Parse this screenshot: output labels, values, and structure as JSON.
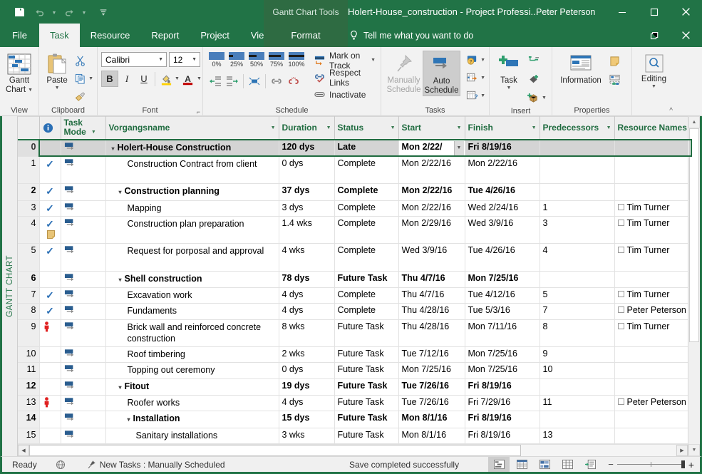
{
  "titlebar": {
    "context_tab_group": "Gantt Chart Tools",
    "document_title": "Holert-House_construction - Project Professi...",
    "user": "Peter Peterson",
    "quick_access": [
      "save-icon",
      "undo-icon",
      "redo-icon",
      "customize-icon"
    ],
    "window_buttons": [
      "minimize",
      "maximize",
      "close"
    ]
  },
  "tabs": {
    "file": "File",
    "items": [
      "Task",
      "Resource",
      "Report",
      "Project",
      "View"
    ],
    "active": "Task",
    "context": "Format",
    "tellme": "Tell me what you want to do"
  },
  "ribbon": {
    "groups": [
      {
        "name": "View",
        "label": "View",
        "buttons": [
          {
            "label_line1": "Gantt",
            "label_line2": "Chart",
            "has_caret": true
          }
        ]
      },
      {
        "name": "Clipboard",
        "label": "Clipboard",
        "buttons": [
          {
            "label_line1": "Paste",
            "has_caret": true
          }
        ],
        "mini": [
          "cut-icon",
          "copy-icon",
          "format-painter-icon"
        ]
      },
      {
        "name": "Font",
        "label": "Font",
        "font_name": "Calibri",
        "font_size": "12",
        "bold": "B",
        "italic": "I",
        "underline": "U",
        "bold_active": true,
        "fill_color": "#ffd100",
        "font_color": "#c00000"
      },
      {
        "name": "Schedule",
        "label": "Schedule",
        "percent_buttons": [
          "0%",
          "25%",
          "50%",
          "75%",
          "100%"
        ],
        "text_buttons": [
          "Mark on Track",
          "Respect Links",
          "Inactivate"
        ]
      },
      {
        "name": "Tasks",
        "label": "Tasks",
        "buttons": [
          {
            "label_line1": "Manually",
            "label_line2": "Schedule",
            "disabled": true
          },
          {
            "label_line1": "Auto",
            "label_line2": "Schedule",
            "active": true
          }
        ]
      },
      {
        "name": "Insert",
        "label": "Insert",
        "buttons": [
          {
            "label_line1": "Task",
            "has_caret": true
          }
        ]
      },
      {
        "name": "Properties",
        "label": "Properties",
        "buttons": [
          {
            "label_line1": "Information"
          }
        ]
      },
      {
        "name": "Editing",
        "label": "",
        "buttons": [
          {
            "label_line1": "Editing",
            "has_caret": true
          }
        ]
      }
    ]
  },
  "view_label": "GANTT CHART",
  "table": {
    "columns": [
      {
        "key": "rownum",
        "label": ""
      },
      {
        "key": "indicator",
        "label": "",
        "icon": "info-icon"
      },
      {
        "key": "mode",
        "label_line1": "Task",
        "label_line2": "Mode",
        "caret": true
      },
      {
        "key": "name",
        "label": "Vorgangsname",
        "caret": true
      },
      {
        "key": "duration",
        "label": "Duration",
        "caret": true
      },
      {
        "key": "status",
        "label": "Status",
        "caret": true
      },
      {
        "key": "start",
        "label": "Start",
        "caret": true
      },
      {
        "key": "finish",
        "label": "Finish",
        "caret": true
      },
      {
        "key": "predecessors",
        "label": "Predecessors",
        "caret": true
      },
      {
        "key": "resources",
        "label": "Resource Names",
        "caret": false
      }
    ],
    "rows": [
      {
        "id": "0",
        "indicator": "",
        "level": 0,
        "summary": true,
        "selected": true,
        "name": "Holert-House Construction",
        "duration": "120 dys",
        "status": "Late",
        "start": "Mon 2/22/",
        "start_editing": true,
        "finish": "Fri 8/19/16",
        "predecessors": "",
        "resources": "",
        "tall": false
      },
      {
        "id": "1",
        "indicator": "check",
        "level": 2,
        "summary": false,
        "name": "Construction Contract from client",
        "duration": "0 dys",
        "status": "Complete",
        "start": "Mon 2/22/16",
        "finish": "Mon 2/22/16",
        "predecessors": "",
        "resources": "",
        "tall": true
      },
      {
        "id": "2",
        "indicator": "check",
        "level": 1,
        "summary": true,
        "name": "Construction planning",
        "duration": "37 dys",
        "status": "Complete",
        "start": "Mon 2/22/16",
        "finish": "Tue 4/26/16",
        "predecessors": "",
        "resources": "",
        "tall": false
      },
      {
        "id": "3",
        "indicator": "check",
        "level": 2,
        "summary": false,
        "name": "Mapping",
        "duration": "3 dys",
        "status": "Complete",
        "start": "Mon 2/22/16",
        "finish": "Wed 2/24/16",
        "predecessors": "1",
        "resources": "Tim Turner",
        "tall": false
      },
      {
        "id": "4",
        "indicator": "check-notes",
        "level": 2,
        "summary": false,
        "name": "Construction plan preparation",
        "duration": "1.4 wks",
        "status": "Complete",
        "start": "Mon 2/29/16",
        "finish": "Wed 3/9/16",
        "predecessors": "3",
        "resources": "Tim Turner",
        "tall": true
      },
      {
        "id": "5",
        "indicator": "check",
        "level": 2,
        "summary": false,
        "name": "Request for porposal and approval",
        "duration": "4 wks",
        "status": "Complete",
        "start": "Wed 3/9/16",
        "finish": "Tue 4/26/16",
        "predecessors": "4",
        "resources": "Tim Turner",
        "tall": true
      },
      {
        "id": "6",
        "indicator": "",
        "level": 1,
        "summary": true,
        "name": "Shell construction",
        "duration": "78 dys",
        "status": "Future Task",
        "start": "Thu 4/7/16",
        "finish": "Mon 7/25/16",
        "predecessors": "",
        "resources": "",
        "tall": false
      },
      {
        "id": "7",
        "indicator": "check",
        "level": 2,
        "summary": false,
        "name": "Excavation work",
        "duration": "4 dys",
        "status": "Complete",
        "start": "Thu 4/7/16",
        "finish": "Tue 4/12/16",
        "predecessors": "5",
        "resources": "Tim Turner",
        "tall": false
      },
      {
        "id": "8",
        "indicator": "check",
        "level": 2,
        "summary": false,
        "name": "Fundaments",
        "duration": "4 dys",
        "status": "Complete",
        "start": "Thu 4/28/16",
        "finish": "Tue 5/3/16",
        "predecessors": "7",
        "resources": "Peter Peterson",
        "tall": false
      },
      {
        "id": "9",
        "indicator": "overalloc",
        "level": 2,
        "summary": false,
        "name": "Brick wall and reinforced concrete construction",
        "duration": "8 wks",
        "status": "Future Task",
        "start": "Thu 4/28/16",
        "finish": "Mon 7/11/16",
        "predecessors": "8",
        "resources": "Tim Turner",
        "tall": true
      },
      {
        "id": "10",
        "indicator": "",
        "level": 2,
        "summary": false,
        "name": "Roof timbering",
        "duration": "2 wks",
        "status": "Future Task",
        "start": "Tue 7/12/16",
        "finish": "Mon 7/25/16",
        "predecessors": "9",
        "resources": "",
        "tall": false
      },
      {
        "id": "11",
        "indicator": "",
        "level": 2,
        "summary": false,
        "name": "Topping out ceremony",
        "duration": "0 dys",
        "status": "Future Task",
        "start": "Mon 7/25/16",
        "finish": "Mon 7/25/16",
        "predecessors": "10",
        "resources": "",
        "tall": false
      },
      {
        "id": "12",
        "indicator": "",
        "level": 1,
        "summary": true,
        "name": "Fitout",
        "duration": "19 dys",
        "status": "Future Task",
        "start": "Tue 7/26/16",
        "finish": "Fri 8/19/16",
        "predecessors": "",
        "resources": "",
        "tall": false
      },
      {
        "id": "13",
        "indicator": "overalloc",
        "level": 2,
        "summary": false,
        "name": "Roofer works",
        "duration": "4 dys",
        "status": "Future Task",
        "start": "Tue 7/26/16",
        "finish": "Fri 7/29/16",
        "predecessors": "11",
        "resources": "Peter Peterson",
        "tall": false
      },
      {
        "id": "14",
        "indicator": "",
        "level": 2,
        "summary": true,
        "name": "Installation",
        "duration": "15 dys",
        "status": "Future Task",
        "start": "Mon 8/1/16",
        "finish": "Fri 8/19/16",
        "predecessors": "",
        "resources": "",
        "tall": false
      },
      {
        "id": "15",
        "indicator": "",
        "level": 3,
        "summary": false,
        "name": "Sanitary installations",
        "duration": "3 wks",
        "status": "Future Task",
        "start": "Mon 8/1/16",
        "finish": "Fri 8/19/16",
        "predecessors": "13",
        "resources": "",
        "tall": false
      }
    ]
  },
  "statusbar": {
    "ready": "Ready",
    "new_tasks": "New Tasks : Manually Scheduled",
    "message": "Save completed successfully",
    "view_buttons": [
      "gantt-chart-view-icon",
      "task-usage-view-icon",
      "team-planner-view-icon",
      "resource-sheet-view-icon",
      "reports-view-icon"
    ],
    "zoom_out": "−",
    "zoom_in": "+"
  },
  "colors": {
    "brand_green": "#217346",
    "header_text": "#1f6b3f",
    "accent_blue": "#2a6fb5",
    "overallocated_red": "#e02020"
  }
}
